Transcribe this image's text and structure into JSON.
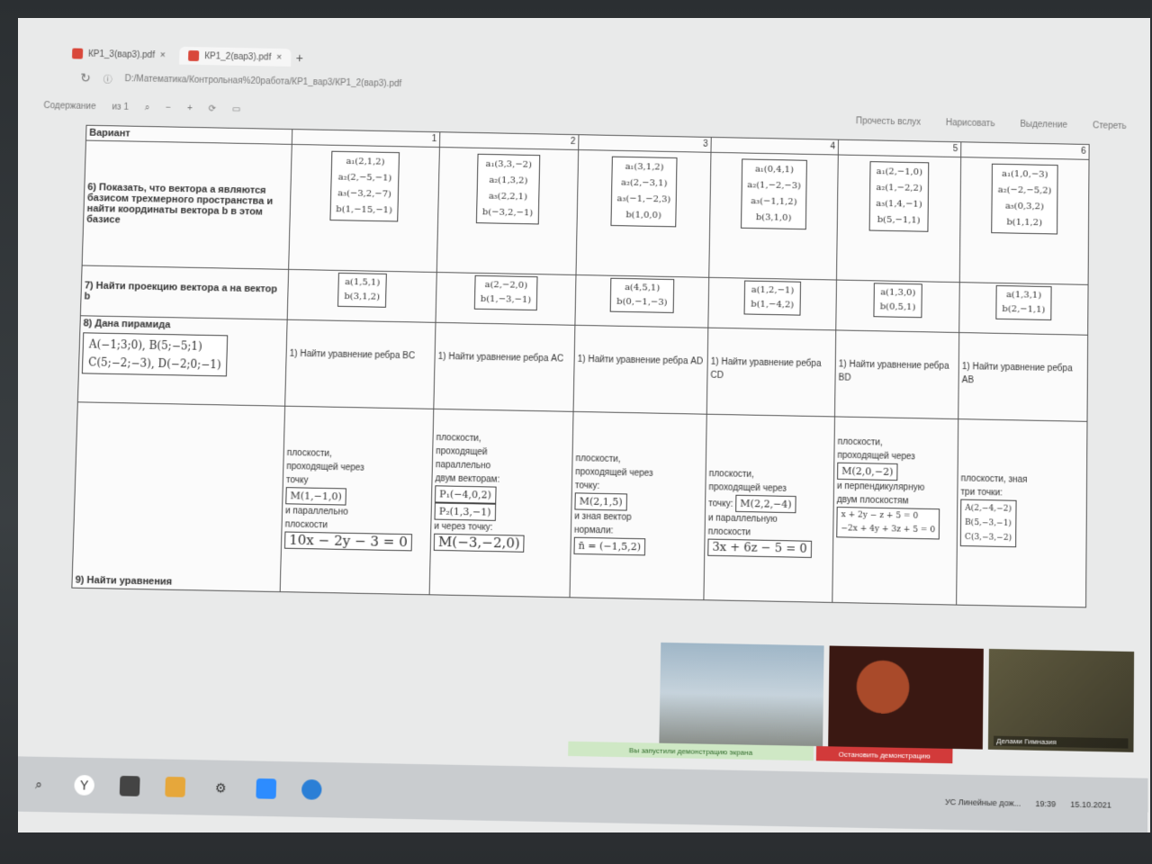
{
  "browser": {
    "tabs": [
      {
        "label": "КР1_3(вар3).pdf"
      },
      {
        "label": "КР1_2(вар3).pdf"
      }
    ],
    "new_tab": "+",
    "address": "D:/Математика/Контрольная%20работа/КР1_вар3/КР1_2(вар3).pdf",
    "left_label": "Содержание",
    "page_indicator": "из 1",
    "tools": {
      "read": "Прочесть вслух",
      "draw": "Нарисовать",
      "highlight": "Выделение",
      "erase": "Стереть"
    }
  },
  "doc": {
    "variant_label": "Вариант",
    "variants": [
      "1",
      "2",
      "3",
      "4",
      "5",
      "6"
    ],
    "task6": {
      "label": "6) Показать, что вектора a являются базисом трехмерного пространства и найти координаты вектора b в этом базисе",
      "cells": [
        [
          "a₁(2,1,2)",
          "a₂(2,−5,−1)",
          "a₃(−3,2,−7)",
          "b(1,−15,−1)"
        ],
        [
          "a₁(3,3,−2)",
          "a₂(1,3,2)",
          "a₃(2,2,1)",
          "b(−3,2,−1)"
        ],
        [
          "a₁(3,1,2)",
          "a₂(2,−3,1)",
          "a₃(−1,−2,3)",
          "b(1,0,0)"
        ],
        [
          "a₁(0,4,1)",
          "a₂(1,−2,−3)",
          "a₃(−1,1,2)",
          "b(3,1,0)"
        ],
        [
          "a₁(2,−1,0)",
          "a₂(1,−2,2)",
          "a₃(1,4,−1)",
          "b(5,−1,1)"
        ],
        [
          "a₁(1,0,−3)",
          "a₂(−2,−5,2)",
          "a₃(0,3,2)",
          "b(1,1,2)"
        ]
      ]
    },
    "task7": {
      "label": "7) Найти проекцию вектора a на вектор b",
      "cells": [
        [
          "a(1,5,1)",
          "b(3,1,2)"
        ],
        [
          "a(2,−2,0)",
          "b(1,−3,−1)"
        ],
        [
          "a(4,5,1)",
          "b(0,−1,−3)"
        ],
        [
          "a(1,2,−1)",
          "b(1,−4,2)"
        ],
        [
          "a(1,3,0)",
          "b(0,5,1)"
        ],
        [
          "a(1,3,1)",
          "b(2,−1,1)"
        ]
      ]
    },
    "task8": {
      "label": "8) Дана пирамида",
      "pyr1": "A(−1;3;0), B(5;−5;1)",
      "pyr2": "C(5;−2;−3), D(−2;0;−1)",
      "cells": [
        "1) Найти уравнение ребра BC",
        "1) Найти уравнение ребра AC",
        "1) Найти уравнение ребра AD",
        "1) Найти уравнение ребра CD",
        "1) Найти уравнение ребра BD",
        "1) Найти уравнение ребра AB"
      ]
    },
    "task9": {
      "label": "9) Найти уравнения",
      "cells": [
        {
          "text": [
            "плоскости,",
            "проходящей через",
            "точку"
          ],
          "box": "M(1,−1,0)",
          "text2": [
            "и параллельно",
            "плоскости"
          ],
          "eq": "10x − 2y − 3 = 0"
        },
        {
          "text": [
            "плоскости,",
            "проходящей",
            "параллельно",
            "двум векторам:"
          ],
          "box": "P₁(−4,0,2)",
          "box2": "P₂(1,3,−1)",
          "text2": [
            "и через точку:"
          ],
          "eq": "M(−3,−2,0)"
        },
        {
          "text": [
            "плоскости,",
            "проходящей через",
            "точку:"
          ],
          "box": "M(2,1,5)",
          "text2": [
            "и зная вектор",
            "нормали:"
          ],
          "eq": "n̄ = (−1,5,2)"
        },
        {
          "text": [
            "плоскости,",
            "проходящей через",
            "точку:"
          ],
          "box": "M(2,2,−4)",
          "text2": [
            "и параллельную",
            "плоскости"
          ],
          "eq": "3x + 6z − 5 = 0"
        },
        {
          "text": [
            "плоскости,",
            "проходящей через"
          ],
          "box": "M(2,0,−2)",
          "text2": [
            "и перпендикулярную",
            "двум плоскостям"
          ],
          "eq": "x + 2y − z + 5 = 0",
          "eq2": "−2x + 4y + 3z + 5 = 0"
        },
        {
          "text": [
            "плоскости, зная",
            "три точки:"
          ],
          "box": "A(2,−4,−2)",
          "box2": "B(5,−3,−1)",
          "box3": "C(3,−3,−2)",
          "text2": [],
          "eq": ""
        }
      ]
    }
  },
  "meeting": {
    "share_notice": "Вы запустили демонстрацию экрана",
    "stop_share": "Остановить демонстрацию",
    "participant": "Делами Гимназия"
  },
  "taskbar": {
    "tray_text": "УС Линейные дож...",
    "time": "19:39",
    "date": "15.10.2021"
  }
}
